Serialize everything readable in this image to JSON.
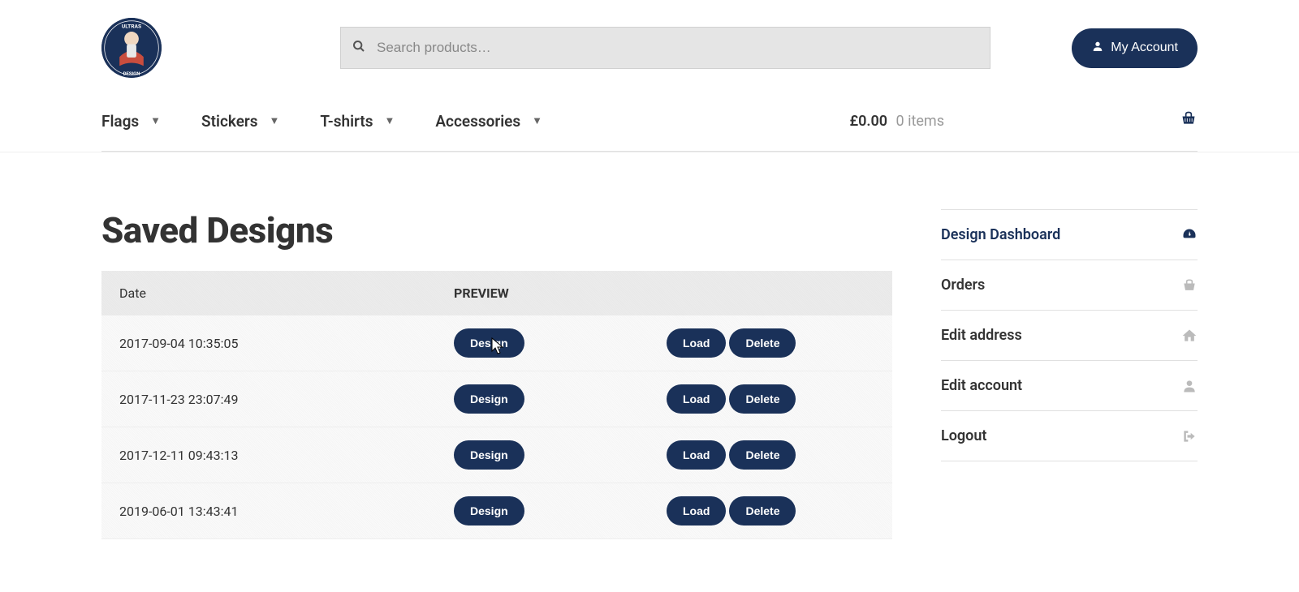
{
  "header": {
    "search_placeholder": "Search products…",
    "account_label": "My Account"
  },
  "nav": {
    "items": [
      "Flags",
      "Stickers",
      "T-shirts",
      "Accessories"
    ],
    "cart_price": "£0.00",
    "cart_items": "0 items"
  },
  "page": {
    "title": "Saved Designs"
  },
  "table": {
    "header_date": "Date",
    "header_preview": "PREVIEW",
    "design_btn": "Design",
    "load_btn": "Load",
    "delete_btn": "Delete",
    "rows": [
      {
        "date": "2017-09-04 10:35:05"
      },
      {
        "date": "2017-11-23 23:07:49"
      },
      {
        "date": "2017-12-11 09:43:13"
      },
      {
        "date": "2019-06-01 13:43:41"
      }
    ]
  },
  "sidebar": {
    "items": [
      {
        "label": "Design Dashboard",
        "icon": "dashboard",
        "active": true
      },
      {
        "label": "Orders",
        "icon": "basket",
        "active": false
      },
      {
        "label": "Edit address",
        "icon": "home",
        "active": false
      },
      {
        "label": "Edit account",
        "icon": "user",
        "active": false
      },
      {
        "label": "Logout",
        "icon": "logout",
        "active": false
      }
    ]
  }
}
